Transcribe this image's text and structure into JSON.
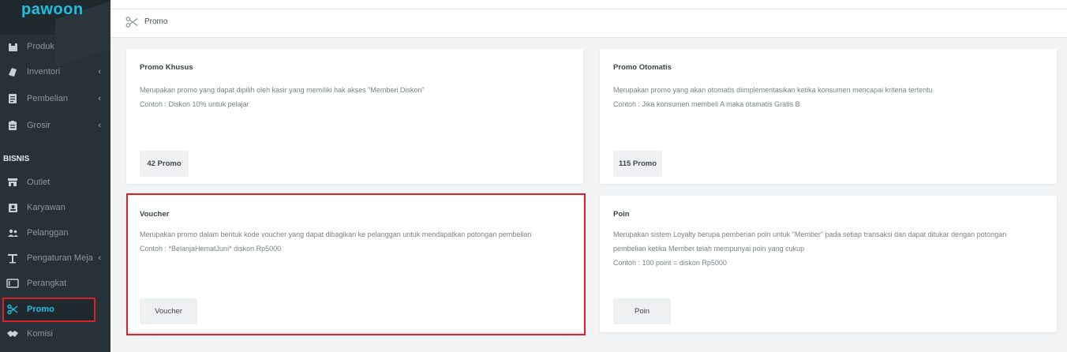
{
  "app": {
    "logo": "pawoon"
  },
  "sidebar": {
    "items": [
      {
        "label": "Produk",
        "icon": "box-icon",
        "chevron": ""
      },
      {
        "label": "Inventori",
        "icon": "inventory-icon",
        "chevron": "‹"
      },
      {
        "label": "Pembelian",
        "icon": "document-icon",
        "chevron": "‹"
      },
      {
        "label": "Grosir",
        "icon": "clipboard-icon",
        "chevron": "‹"
      }
    ],
    "section_label": "BISNIS",
    "business_items": [
      {
        "label": "Outlet",
        "icon": "store-icon",
        "chevron": ""
      },
      {
        "label": "Karyawan",
        "icon": "person-card-icon",
        "chevron": ""
      },
      {
        "label": "Pelanggan",
        "icon": "people-icon",
        "chevron": ""
      },
      {
        "label": "Pengaturan Meja",
        "icon": "table-icon",
        "chevron": "‹"
      },
      {
        "label": "Perangkat",
        "icon": "device-icon",
        "chevron": ""
      },
      {
        "label": "Promo",
        "icon": "scissors-icon",
        "chevron": ""
      },
      {
        "label": "Komisi",
        "icon": "handshake-icon",
        "chevron": ""
      }
    ],
    "active_item": "Promo"
  },
  "breadcrumb": {
    "label": "Promo",
    "icon": "scissors-icon"
  },
  "cards": {
    "promo_khusus": {
      "title": "Promo Khusus",
      "desc1": "Merupakan promo yang dapat dipilih oleh kasir yang memiliki hak akses \"Memberi Diskon\"",
      "desc2": "Contoh : Diskon 10% untuk pelajar",
      "button": "42 Promo"
    },
    "promo_otomatis": {
      "title": "Promo Otomatis",
      "desc1": "Merupakan promo yang akan otomatis diimplementasikan ketika konsumen mencapai kriteria tertentu",
      "desc2": "Contoh : Jika konsumen membeli A maka otamatis Gratis B",
      "button": "115 Promo"
    },
    "voucher": {
      "title": "Voucher",
      "desc1": "Merupakan promo dalam bentuk kode voucher yang dapat dibagikan ke pelanggan untuk mendapatkan potongan pembelian",
      "desc2": "Contoh : *BelanjaHematJuni* diskon Rp5000",
      "button": "Voucher"
    },
    "poin": {
      "title": "Poin",
      "desc1": "Merupakan sistem Loyalty berupa pemberian poin untuk \"Member\" pada setiap transaksi dan dapat ditukar dengan potongan",
      "desc2": "pembelian ketika Member telah mempunyai poin yang cukup",
      "desc3": "Contoh : 100 point = diskon Rp5000",
      "button": "Poin"
    }
  },
  "colors": {
    "accent": "#20c0e4",
    "highlight": "#d8232a",
    "sidebar": "#263238"
  }
}
